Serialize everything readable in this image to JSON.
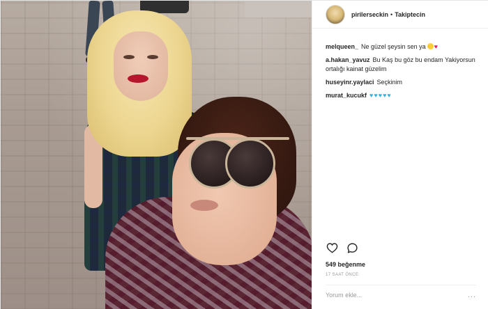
{
  "post": {
    "header": {
      "username": "pirilerseckin",
      "separator": "•",
      "follow_status": "Takipteсin"
    },
    "comments": [
      {
        "user": "melqueen_",
        "text": "Ne güzel şeysin sen ya",
        "emoji": [
          "heart-eyes-face",
          "red-heart"
        ]
      },
      {
        "user": "a.hakan_yavuz",
        "text": "Bu Kaş bu göz bu endam Yakiyorsun ortalığı kainat güzelim"
      },
      {
        "user": "huseyinr.yaylaci",
        "text": "Seçkinim"
      },
      {
        "user": "murat_kucukf",
        "text": "",
        "hearts": "♥♥♥♥♥",
        "heart_color": "#3ab0d8"
      }
    ],
    "actions": {
      "like_icon": "heart-outline-icon",
      "comment_icon": "comment-bubble-icon"
    },
    "likes": "549 beğenme",
    "time": "17 SAAT ÖNCE",
    "add_comment": {
      "placeholder": "Yorum ekle...",
      "more": "..."
    }
  },
  "colors": {
    "username": "#262626",
    "muted": "#999999",
    "border": "#efefef",
    "accent_hearts": "#3ab0d8"
  }
}
